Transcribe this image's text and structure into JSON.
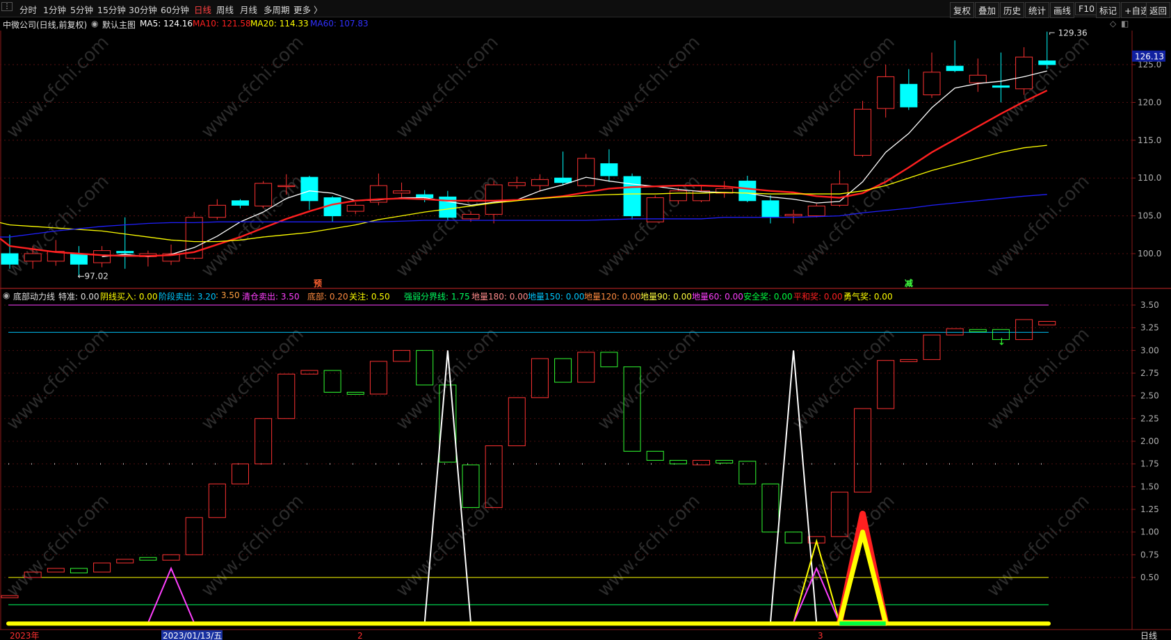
{
  "toolbar": {
    "left_items": [
      "分时",
      "1分钟",
      "5分钟",
      "15分钟",
      "30分钟",
      "60分钟",
      "日线",
      "周线",
      "月线",
      "多周期",
      "更多 〉"
    ],
    "active": "日线",
    "right_items": [
      "复权",
      "叠加",
      "历史",
      "统计",
      "画线",
      "F10",
      "标记",
      "+自选",
      "返回"
    ]
  },
  "main_chart": {
    "stock_title": "中微公司(日线,前复权)",
    "template": "默认主图",
    "ma_readouts": [
      {
        "label": "MA5: 124.16",
        "color": "#ffffff"
      },
      {
        "label": "MA10: 121.58",
        "color": "#ff2020"
      },
      {
        "label": "MA20: 114.33",
        "color": "#ffff00"
      },
      {
        "label": "MA60: 107.83",
        "color": "#2020ff"
      }
    ],
    "current_price_tag": "126.13",
    "high_label": "129.36",
    "low_label": "97.02",
    "markers": [
      "预",
      "减"
    ]
  },
  "indicator": {
    "name": "底部动力线",
    "params": [
      {
        "label": "特准: 0.00",
        "color": "#e0e0e0"
      },
      {
        "label": "阴线买入: 0.00",
        "color": "#ffff00"
      },
      {
        "label": "阶段卖出: 3.20",
        "color": "#00c8ff"
      },
      {
        "label": ": 3.50",
        "color": "#ffa040"
      },
      {
        "label": "清仓卖出: 3.50",
        "color": "#ff40ff"
      },
      {
        "label": "底部: 0.20",
        "color": "#ff8c40"
      },
      {
        "label": "关注: 0.50",
        "color": "#ffff00"
      },
      {
        "label": "强弱分界线: 1.75",
        "color": "#00ff60"
      },
      {
        "label": "地量180: 0.00",
        "color": "#ff8c8c"
      },
      {
        "label": "地量150: 0.00",
        "color": "#00c8ff"
      },
      {
        "label": "地量120: 0.00",
        "color": "#ff8c40"
      },
      {
        "label": "地量90: 0.00",
        "color": "#ffff40"
      },
      {
        "label": "地量60: 0.00",
        "color": "#ff40ff"
      },
      {
        "label": "安全奖: 0.00",
        "color": "#00ff40"
      },
      {
        "label": "平和奖: 0.00",
        "color": "#ff2020"
      },
      {
        "label": "勇气奖: 0.00",
        "color": "#ffff00"
      }
    ]
  },
  "date_axis": {
    "labels": [
      "2023年",
      "2023/01/13/五",
      "2",
      "3"
    ],
    "period_label": "日线"
  },
  "watermark_text": "www.cfchi.com",
  "chart_data": [
    {
      "type": "candlestick",
      "title": "中微公司(日线,前复权)",
      "y_ticks": [
        100.0,
        105.0,
        110.0,
        115.0,
        120.0,
        125.0
      ],
      "ylim": [
        96,
        131
      ],
      "candles": [
        {
          "o": 100.0,
          "c": 98.6,
          "h": 102.5,
          "l": 98.0
        },
        {
          "o": 99.0,
          "c": 100.0,
          "h": 101.0,
          "l": 98.0
        },
        {
          "o": 99.0,
          "c": 100.3,
          "h": 101.8,
          "l": 98.4
        },
        {
          "o": 100.0,
          "c": 98.6,
          "h": 101.0,
          "l": 97.0
        },
        {
          "o": 98.8,
          "c": 100.4,
          "h": 101.0,
          "l": 98.2
        },
        {
          "o": 100.3,
          "c": 100.1,
          "h": 104.8,
          "l": 98.0
        },
        {
          "o": 99.6,
          "c": 100.0,
          "h": 100.4,
          "l": 98.3
        },
        {
          "o": 99.0,
          "c": 100.0,
          "h": 101.2,
          "l": 98.5
        },
        {
          "o": 99.4,
          "c": 104.8,
          "h": 105.5,
          "l": 99.2
        },
        {
          "o": 104.8,
          "c": 106.4,
          "h": 107.2,
          "l": 104.5
        },
        {
          "o": 107.0,
          "c": 106.4,
          "h": 107.2,
          "l": 106.0
        },
        {
          "o": 106.3,
          "c": 109.3,
          "h": 109.6,
          "l": 106.0
        },
        {
          "o": 109.0,
          "c": 109.0,
          "h": 110.5,
          "l": 107.8
        },
        {
          "o": 110.1,
          "c": 107.0,
          "h": 110.3,
          "l": 105.8
        },
        {
          "o": 107.4,
          "c": 105.0,
          "h": 107.6,
          "l": 104.2
        },
        {
          "o": 105.6,
          "c": 106.4,
          "h": 106.8,
          "l": 105.2
        },
        {
          "o": 106.8,
          "c": 109.0,
          "h": 110.6,
          "l": 106.4
        },
        {
          "o": 108.0,
          "c": 108.3,
          "h": 109.4,
          "l": 107.2
        },
        {
          "o": 107.8,
          "c": 107.4,
          "h": 108.4,
          "l": 106.8
        },
        {
          "o": 107.5,
          "c": 104.8,
          "h": 108.3,
          "l": 104.4
        },
        {
          "o": 104.6,
          "c": 105.2,
          "h": 105.6,
          "l": 104.2
        },
        {
          "o": 105.2,
          "c": 109.1,
          "h": 109.6,
          "l": 104.0
        },
        {
          "o": 109.0,
          "c": 109.4,
          "h": 110.2,
          "l": 108.6
        },
        {
          "o": 109.0,
          "c": 109.8,
          "h": 110.5,
          "l": 108.2
        },
        {
          "o": 110.0,
          "c": 109.4,
          "h": 113.5,
          "l": 109.0
        },
        {
          "o": 109.0,
          "c": 112.6,
          "h": 113.2,
          "l": 108.8
        },
        {
          "o": 111.9,
          "c": 110.3,
          "h": 113.8,
          "l": 109.5
        },
        {
          "o": 110.2,
          "c": 105.0,
          "h": 110.6,
          "l": 104.5
        },
        {
          "o": 104.2,
          "c": 107.4,
          "h": 107.7,
          "l": 104.2
        },
        {
          "o": 107.0,
          "c": 108.3,
          "h": 108.7,
          "l": 106.6
        },
        {
          "o": 107.0,
          "c": 108.3,
          "h": 109.0,
          "l": 106.8
        },
        {
          "o": 108.0,
          "c": 108.6,
          "h": 109.6,
          "l": 107.4
        },
        {
          "o": 109.6,
          "c": 107.0,
          "h": 110.3,
          "l": 106.8
        },
        {
          "o": 107.0,
          "c": 104.8,
          "h": 107.7,
          "l": 104.0
        },
        {
          "o": 105.0,
          "c": 105.2,
          "h": 105.8,
          "l": 104.0
        },
        {
          "o": 105.0,
          "c": 106.3,
          "h": 106.6,
          "l": 104.8
        },
        {
          "o": 106.4,
          "c": 109.2,
          "h": 111.0,
          "l": 106.2
        },
        {
          "o": 113.0,
          "c": 119.1,
          "h": 120.2,
          "l": 112.8
        },
        {
          "o": 119.2,
          "c": 123.4,
          "h": 125.0,
          "l": 118.0
        },
        {
          "o": 122.4,
          "c": 119.4,
          "h": 124.4,
          "l": 119.0
        },
        {
          "o": 121.0,
          "c": 124.0,
          "h": 126.6,
          "l": 120.6
        },
        {
          "o": 124.8,
          "c": 124.2,
          "h": 128.2,
          "l": 124.0
        },
        {
          "o": 122.6,
          "c": 123.6,
          "h": 125.8,
          "l": 121.4
        },
        {
          "o": 122.2,
          "c": 122.0,
          "h": 126.6,
          "l": 120.0
        },
        {
          "o": 121.8,
          "c": 126.0,
          "h": 127.3,
          "l": 121.0
        },
        {
          "o": 125.5,
          "c": 125.0,
          "h": 129.36,
          "l": 124.4
        }
      ],
      "series": [
        {
          "name": "MA5",
          "color": "#ffffff",
          "values": [
            null,
            null,
            null,
            null,
            99.6,
            99.9,
            99.6,
            99.9,
            100.8,
            102.3,
            104.2,
            105.5,
            107.3,
            108.3,
            108.0,
            107.0,
            107.1,
            107.4,
            107.4,
            106.9,
            106.4,
            106.8,
            107.1,
            108.3,
            109.1,
            110.1,
            109.6,
            109.2,
            108.9,
            108.5,
            108.2,
            108.1,
            108.0,
            107.5,
            107.2,
            106.7,
            106.9,
            109.5,
            113.4,
            115.9,
            119.3,
            121.9,
            122.5,
            122.8,
            123.4,
            124.16
          ]
        },
        {
          "name": "MA10",
          "color": "#ff2020",
          "values": [
            101.0,
            100.6,
            100.2,
            100.0,
            99.8,
            99.7,
            99.7,
            99.8,
            100.2,
            101.2,
            102.2,
            103.4,
            104.6,
            105.6,
            106.5,
            107.0,
            107.2,
            107.3,
            107.2,
            107.0,
            107.0,
            107.0,
            107.1,
            107.3,
            107.6,
            108.1,
            108.6,
            108.8,
            108.9,
            109.0,
            109.0,
            108.9,
            108.6,
            108.3,
            108.1,
            107.6,
            107.4,
            108.0,
            109.5,
            111.4,
            113.4,
            115.1,
            116.8,
            118.5,
            120.1,
            121.58
          ]
        },
        {
          "name": "MA20",
          "color": "#ffff00",
          "values": [
            103.8,
            103.6,
            103.4,
            103.2,
            103.0,
            102.6,
            102.2,
            101.8,
            101.6,
            101.6,
            101.8,
            102.2,
            102.5,
            102.8,
            103.3,
            103.8,
            104.5,
            105.0,
            105.5,
            105.9,
            106.3,
            106.7,
            107.0,
            107.3,
            107.5,
            107.7,
            107.8,
            107.9,
            107.9,
            108.0,
            108.0,
            108.1,
            108.0,
            107.9,
            107.9,
            107.9,
            107.9,
            108.3,
            109.0,
            110.0,
            111.0,
            111.8,
            112.6,
            113.4,
            114.0,
            114.33
          ]
        },
        {
          "name": "MA60",
          "color": "#2020ff",
          "values": [
            102.2,
            102.6,
            103.0,
            103.3,
            103.6,
            103.8,
            104.0,
            104.1,
            104.1,
            104.2,
            104.2,
            104.2,
            104.2,
            104.2,
            104.2,
            104.2,
            104.2,
            104.3,
            104.4,
            104.4,
            104.4,
            104.4,
            104.4,
            104.4,
            104.4,
            104.4,
            104.5,
            104.6,
            104.6,
            104.6,
            104.6,
            104.8,
            104.8,
            104.8,
            104.8,
            104.9,
            105.0,
            105.4,
            105.7,
            106.0,
            106.4,
            106.7,
            107.0,
            107.3,
            107.6,
            107.83
          ]
        }
      ]
    },
    {
      "type": "candlestick",
      "title": "底部动力线",
      "y_ticks": [
        0.5,
        0.75,
        1.0,
        1.25,
        1.5,
        1.75,
        2.0,
        2.25,
        2.5,
        2.75,
        3.0,
        3.25,
        3.5
      ],
      "ylim": [
        -0.08,
        3.62
      ],
      "reference_lines": [
        {
          "value": 3.5,
          "color": "#ff40ff"
        },
        {
          "value": 3.2,
          "color": "#00c8ff"
        },
        {
          "value": 1.75,
          "color": "#00ff60",
          "style": "dotted"
        },
        {
          "value": 0.5,
          "color": "#ffff00"
        },
        {
          "value": 0.2,
          "color": "#00ff60"
        }
      ],
      "candles": [
        {
          "o": 0.3,
          "c": 0.3
        },
        {
          "o": 0.5,
          "c": 0.56
        },
        {
          "o": 0.56,
          "c": 0.6
        },
        {
          "o": 0.6,
          "c": 0.55
        },
        {
          "o": 0.56,
          "c": 0.66
        },
        {
          "o": 0.66,
          "c": 0.7
        },
        {
          "o": 0.72,
          "c": 0.69
        },
        {
          "o": 0.69,
          "c": 0.75
        },
        {
          "o": 0.75,
          "c": 1.16
        },
        {
          "o": 1.16,
          "c": 1.53
        },
        {
          "o": 1.53,
          "c": 1.75
        },
        {
          "o": 1.75,
          "c": 2.25
        },
        {
          "o": 2.25,
          "c": 2.74
        },
        {
          "o": 2.74,
          "c": 2.78
        },
        {
          "o": 2.78,
          "c": 2.54
        },
        {
          "o": 2.54,
          "c": 2.52
        },
        {
          "o": 2.52,
          "c": 2.88
        },
        {
          "o": 2.88,
          "c": 3.0
        },
        {
          "o": 3.0,
          "c": 2.62
        },
        {
          "o": 2.62,
          "c": 1.77
        },
        {
          "o": 1.74,
          "c": 1.27
        },
        {
          "o": 1.27,
          "c": 1.95
        },
        {
          "o": 1.95,
          "c": 2.48
        },
        {
          "o": 2.48,
          "c": 2.91
        },
        {
          "o": 2.91,
          "c": 2.65
        },
        {
          "o": 2.65,
          "c": 2.98
        },
        {
          "o": 2.98,
          "c": 2.82
        },
        {
          "o": 2.82,
          "c": 1.89
        },
        {
          "o": 1.89,
          "c": 1.79
        },
        {
          "o": 1.79,
          "c": 1.75
        },
        {
          "o": 1.74,
          "c": 1.79
        },
        {
          "o": 1.79,
          "c": 1.76
        },
        {
          "o": 1.78,
          "c": 1.53
        },
        {
          "o": 1.53,
          "c": 1.0
        },
        {
          "o": 1.0,
          "c": 0.88
        },
        {
          "o": 0.88,
          "c": 0.95
        },
        {
          "o": 0.95,
          "c": 1.44
        },
        {
          "o": 1.44,
          "c": 2.36
        },
        {
          "o": 2.36,
          "c": 2.89
        },
        {
          "o": 2.89,
          "c": 2.9
        },
        {
          "o": 2.9,
          "c": 3.17
        },
        {
          "o": 3.17,
          "c": 3.24
        },
        {
          "o": 3.23,
          "c": 3.22
        },
        {
          "o": 3.23,
          "c": 3.12
        },
        {
          "o": 3.12,
          "c": 3.34
        },
        {
          "o": 3.28,
          "c": 3.32
        }
      ],
      "signals": [
        {
          "name": "底部",
          "color": "#ff40ff",
          "start": 6,
          "peak": 7,
          "end": 8,
          "value": 0.6
        },
        {
          "name": "白线",
          "color": "#ffffff",
          "start": 18,
          "peak": 19,
          "end": 20,
          "value": 3.0
        },
        {
          "name": "白线",
          "color": "#ffffff",
          "start": 33,
          "peak": 34,
          "end": 35,
          "value": 3.0
        },
        {
          "name": "关注",
          "color": "#ffff00",
          "start": 34,
          "peak": 35,
          "end": 36,
          "value": 0.9
        },
        {
          "name": "底部",
          "color": "#ff40ff",
          "start": 34,
          "peak": 35,
          "end": 36,
          "value": 0.6
        },
        {
          "name": "平和奖",
          "color": "#ff2020",
          "start": 36,
          "peak": 37,
          "end": 38,
          "value": 1.2
        },
        {
          "name": "勇气奖",
          "color": "#ffff00",
          "start": 36,
          "peak": 37,
          "end": 38,
          "value": 1.0
        }
      ]
    }
  ]
}
